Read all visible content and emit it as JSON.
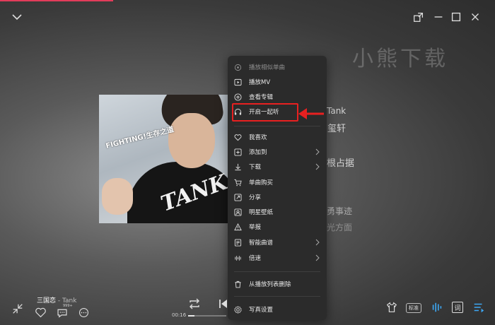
{
  "watermark": "小熊下载",
  "cover": {
    "fighting_text": "FIGHTING!生存之道",
    "logo_text": "TANK"
  },
  "lyrics": [
    "Tank",
    "湘玺轩",
    "根占据",
    "勇事迹",
    "光方面"
  ],
  "context_menu": {
    "header": "播放相似单曲",
    "items": [
      {
        "label": "播放MV",
        "icon": "mv-icon"
      },
      {
        "label": "查看专辑",
        "icon": "album-icon"
      },
      {
        "label": "开启一起听",
        "icon": "headphones-icon"
      },
      {
        "label": "我喜欢",
        "icon": "heart-icon"
      },
      {
        "label": "添加到",
        "icon": "add-icon",
        "submenu": true
      },
      {
        "label": "下载",
        "icon": "download-icon",
        "submenu": true
      },
      {
        "label": "单曲购买",
        "icon": "cart-icon"
      },
      {
        "label": "分享",
        "icon": "share-icon"
      },
      {
        "label": "明星壁纸",
        "icon": "wallpaper-icon"
      },
      {
        "label": "举报",
        "icon": "report-icon"
      },
      {
        "label": "智能曲谱",
        "icon": "score-icon",
        "submenu": true
      },
      {
        "label": "倍速",
        "icon": "speed-icon",
        "submenu": true
      },
      {
        "label": "从播放列表删除",
        "icon": "trash-icon"
      },
      {
        "label": "写真设置",
        "icon": "settings-icon"
      }
    ]
  },
  "player": {
    "song_title": "三国恋",
    "separator": " - ",
    "artist": "Tank",
    "comment_count": "999+",
    "current_time": "00:16",
    "progress_fraction": 0.17,
    "sound_quality_label": "标准",
    "lyrics_button_label": "词"
  },
  "colors": {
    "accent": "#e23c5a",
    "highlight_red": "#e82020",
    "menu_bg": "#2b2b2b",
    "link_blue": "#3da8f5"
  }
}
